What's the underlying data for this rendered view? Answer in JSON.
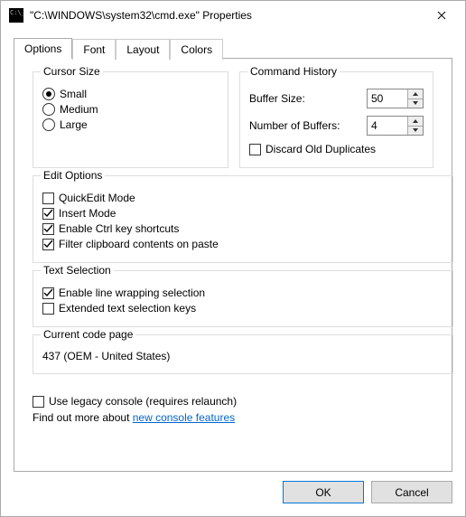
{
  "window": {
    "title": "\"C:\\WINDOWS\\system32\\cmd.exe\" Properties"
  },
  "tabs": {
    "options": "Options",
    "font": "Font",
    "layout": "Layout",
    "colors": "Colors"
  },
  "cursor": {
    "legend": "Cursor Size",
    "small": "Small",
    "medium": "Medium",
    "large": "Large"
  },
  "history": {
    "legend": "Command History",
    "buffer_size_label": "Buffer Size:",
    "buffer_size_value": "50",
    "num_buffers_label": "Number of Buffers:",
    "num_buffers_value": "4",
    "discard": "Discard Old Duplicates"
  },
  "edit": {
    "legend": "Edit Options",
    "quickedit": "QuickEdit Mode",
    "insert": "Insert Mode",
    "ctrlkeys": "Enable Ctrl key shortcuts",
    "filterpaste": "Filter clipboard contents on paste"
  },
  "textsel": {
    "legend": "Text Selection",
    "linewrap": "Enable line wrapping selection",
    "extended": "Extended text selection keys"
  },
  "codepage": {
    "legend": "Current code page",
    "value": "437  (OEM - United States)"
  },
  "footer": {
    "legacy": "Use legacy console (requires relaunch)",
    "findout_prefix": "Find out more about ",
    "findout_link": "new console features"
  },
  "buttons": {
    "ok": "OK",
    "cancel": "Cancel"
  }
}
